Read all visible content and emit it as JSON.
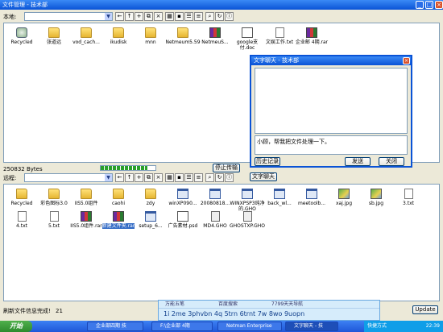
{
  "window": {
    "title": "文件管理 - 技术部",
    "buttons": [
      "_",
      "□",
      "×"
    ]
  },
  "local": {
    "label": "本地:",
    "path": "",
    "files": [
      {
        "name": "Recycled",
        "type": "recycle"
      },
      {
        "name": "张道远",
        "type": "folder"
      },
      {
        "name": "vod_cach...",
        "type": "folder"
      },
      {
        "name": "ikudisk",
        "type": "folder"
      },
      {
        "name": "mnn",
        "type": "folder"
      },
      {
        "name": "Netmeum5.59",
        "type": "folder"
      },
      {
        "name": "NetmeuS...",
        "type": "rar"
      },
      {
        "name": "google支付.doc",
        "type": "doc"
      },
      {
        "name": "文娱工作.txt",
        "type": "txt"
      },
      {
        "name": "企业邮 4期.rar",
        "type": "rar"
      }
    ],
    "status": "250832 Bytes",
    "progress": 0.86
  },
  "transfer": {
    "stop_label": "停止传输"
  },
  "remote": {
    "label": "远程:",
    "path": "",
    "chat_label": "文字聊天",
    "files": [
      {
        "name": "Recycled",
        "type": "folder"
      },
      {
        "name": "彩色图标3.0",
        "type": "folder"
      },
      {
        "name": "IIS5.0组件",
        "type": "folder"
      },
      {
        "name": "caohi",
        "type": "folder"
      },
      {
        "name": "zdy",
        "type": "folder"
      },
      {
        "name": "winXP090...",
        "type": "exe"
      },
      {
        "name": "20080818...",
        "type": "exe"
      },
      {
        "name": "WINXPSP3纯净的.GHO",
        "type": "exe"
      },
      {
        "name": "back_wl...",
        "type": "exe"
      },
      {
        "name": "meetoolb...",
        "type": "exe"
      },
      {
        "name": "xaj.jpg",
        "type": "img"
      },
      {
        "name": "sb.jpg",
        "type": "img"
      },
      {
        "name": "3.txt",
        "type": "txt"
      },
      {
        "name": "4.txt",
        "type": "txt"
      },
      {
        "name": "5.txt",
        "type": "txt"
      },
      {
        "name": "IIS5.0组件.rar",
        "type": "rar"
      },
      {
        "name": "新建文件夹.rar",
        "type": "rar",
        "selected": true
      },
      {
        "name": "setup_6...",
        "type": "exe"
      },
      {
        "name": "广告素材.psd",
        "type": "doc"
      },
      {
        "name": "MD4.GHO",
        "type": "gho"
      },
      {
        "name": "GHOSTXP.GHO",
        "type": "gho"
      }
    ],
    "status": "刷新文件信息完成!",
    "count": "21",
    "update_label": "Update"
  },
  "chat": {
    "title": "文字聊天 - 技术部",
    "message": "小顾，帮我把文件处理一下。",
    "history_label": "历史记录",
    "send_label": "发送",
    "close_label": "关闭"
  },
  "ime": {
    "tabs": [
      "万能五笔",
      "百度搜索",
      "7799天天导航"
    ],
    "candidates": "1i 2me 3phvbn 4q 5trn 6trnt 7w 8wo 9uopn"
  },
  "taskbar": {
    "start_label": "开始",
    "tasks": [
      "企业部四期 技",
      "F:\\企业部 4期",
      "Netman Enterprise",
      "文字聊天 - 技"
    ],
    "tray_text": "快捷方式",
    "clock": "22:39"
  }
}
